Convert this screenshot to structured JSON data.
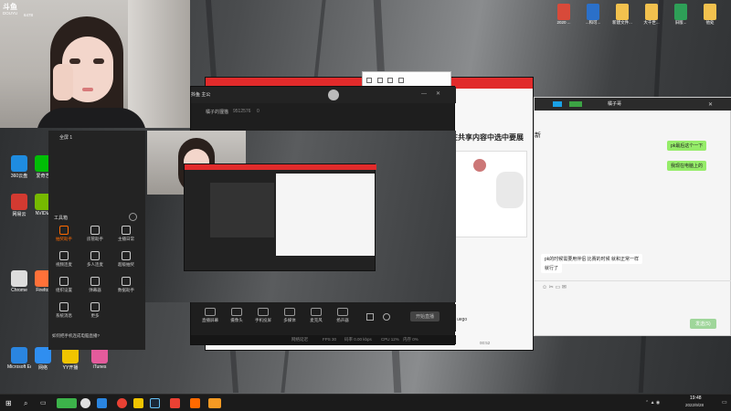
{
  "stream": {
    "badge_line1": "斗鱼",
    "badge_line2": "DOUYU",
    "room_id": "6478"
  },
  "desktop_icons": [
    {
      "label": "360云盘",
      "color": "#1f8ce0"
    },
    {
      "label": "爱奇艺",
      "color": "#00be06"
    },
    {
      "label": "网易云",
      "color": "#d33a31"
    },
    {
      "label": "NVIDIA",
      "color": "#76b900"
    },
    {
      "label": "Chrome",
      "color": "#dddddd"
    },
    {
      "label": "Firefox",
      "color": "#ff7139"
    },
    {
      "label": "Microsoft Edge",
      "color": "#2a85e0"
    },
    {
      "label": "网络",
      "color": "#2f8ef0"
    },
    {
      "label": "YY开播",
      "color": "#f0c400"
    },
    {
      "label": "iTunes",
      "color": "#e45b9c"
    }
  ],
  "desktop_files": [
    {
      "label": "2020 ...",
      "color": "#d84a3a"
    },
    {
      "label": "...和可...",
      "color": "#2b70c9"
    },
    {
      "label": "新建文件...",
      "color": "#f2c14e"
    },
    {
      "label": "大千世...",
      "color": "#f2c14e"
    },
    {
      "label": "旧版...",
      "color": "#2e9f57"
    },
    {
      "label": "他处",
      "color": "#f2c14e"
    }
  ],
  "douyu_window": {
    "title": "抖鱼 主公",
    "sub_title": "橘子的狸猫",
    "room": "9512576",
    "hot": "0",
    "share_label": "全屏 1",
    "tools_label": "工具箱",
    "tools": [
      {
        "label": "抽奖助手",
        "color": "#ff6a00"
      },
      {
        "label": "房管助手",
        "color": "#cccccc"
      },
      {
        "label": "主播日常",
        "color": "#cccccc"
      },
      {
        "label": "视频连麦",
        "color": "#cccccc"
      },
      {
        "label": "多人连麦",
        "color": "#cccccc"
      },
      {
        "label": "超级抽奖",
        "color": "#cccccc"
      },
      {
        "label": "组织设置",
        "color": "#cccccc"
      },
      {
        "label": "弹幕器",
        "color": "#cccccc"
      },
      {
        "label": "数据助手",
        "color": "#cccccc"
      },
      {
        "label": "系统消息",
        "color": "#cccccc"
      },
      {
        "label": "更多",
        "color": "#cccccc"
      }
    ],
    "notice": "如何把手机连成电脑直播?",
    "bottom_buttons": [
      "直播屏幕",
      "摄像头",
      "手机投屏",
      "多媒体",
      "麦克风",
      "扬声器"
    ],
    "start_button": "开始直播",
    "status": {
      "left": "网络延迟",
      "fps": "FPS 30",
      "bitrate": "码率 0.00 kbps",
      "cpu": "CPU 12%",
      "mem": "内存 0%"
    }
  },
  "browser_window": {
    "heading": "在共享内容中选中要展",
    "footer_tag": "uego",
    "timer": "00:52"
  },
  "chat_window": {
    "title": "橘子哥",
    "header_tab": "新",
    "messages": [
      {
        "side": "right",
        "text": "pk最后这个一下"
      },
      {
        "side": "right",
        "text": "我现在电脑上的"
      },
      {
        "side": "left",
        "text": "pk的时候需要用伴侣 比赛的时候 就和正常一样"
      },
      {
        "side": "left",
        "text": "就行了"
      }
    ],
    "send_button": "发送(S)"
  },
  "clock": {
    "time": "19:48",
    "date": "2022/9/28"
  }
}
